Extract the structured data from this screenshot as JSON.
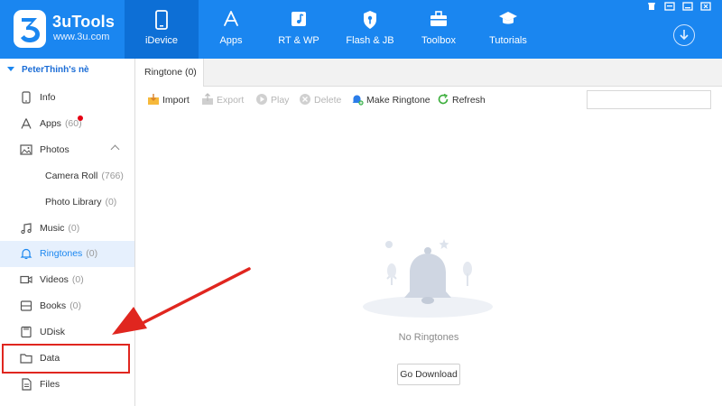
{
  "app": {
    "brand_name": "3uTools",
    "brand_url": "www.3u.com",
    "accent_color": "#1a86f0"
  },
  "nav": [
    {
      "label": "iDevice",
      "icon": "phone-icon",
      "active": true
    },
    {
      "label": "Apps",
      "icon": "app-store-icon",
      "active": false
    },
    {
      "label": "RT & WP",
      "icon": "music-note-icon",
      "active": false
    },
    {
      "label": "Flash & JB",
      "icon": "shield-key-icon",
      "active": false
    },
    {
      "label": "Toolbox",
      "icon": "toolbox-icon",
      "active": false
    },
    {
      "label": "Tutorials",
      "icon": "graduation-cap-icon",
      "active": false
    }
  ],
  "sidebar": {
    "device_name": "PeterThinh's nè",
    "items": [
      {
        "label": "Info",
        "count": "",
        "icon": "phone-icon"
      },
      {
        "label": "Apps",
        "count": "(60)",
        "icon": "app-store-icon",
        "badge": "red-dot"
      },
      {
        "label": "Photos",
        "count": "",
        "icon": "image-icon",
        "expanded": true
      },
      {
        "label": "Camera Roll",
        "count": "(766)",
        "sub": true
      },
      {
        "label": "Photo Library",
        "count": "(0)",
        "sub": true
      },
      {
        "label": "Music",
        "count": "(0)",
        "icon": "music-note-icon"
      },
      {
        "label": "Ringtones",
        "count": "(0)",
        "icon": "bell-icon",
        "active": true
      },
      {
        "label": "Videos",
        "count": "(0)",
        "icon": "video-icon"
      },
      {
        "label": "Books",
        "count": "(0)",
        "icon": "book-icon"
      },
      {
        "label": "UDisk",
        "count": "",
        "icon": "udisk-icon"
      },
      {
        "label": "Data",
        "count": "",
        "icon": "folder-icon",
        "highlighted": true
      },
      {
        "label": "Files",
        "count": "",
        "icon": "file-icon"
      }
    ]
  },
  "tabs": [
    {
      "label": "Ringtone (0)",
      "active": true
    }
  ],
  "toolbar": {
    "import": "Import",
    "export": "Export",
    "play": "Play",
    "delete": "Delete",
    "make_ringtone": "Make Ringtone",
    "refresh": "Refresh"
  },
  "empty_state": {
    "message": "No Ringtones",
    "button": "Go Download"
  },
  "annotation": {
    "highlight_color": "#e0261f"
  }
}
